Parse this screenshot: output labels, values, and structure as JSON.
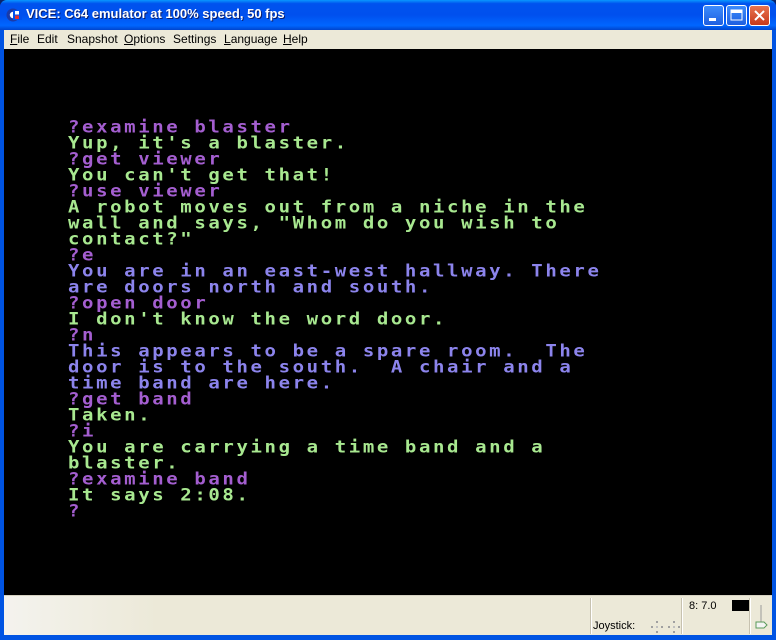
{
  "window": {
    "title": "VICE: C64 emulator at 100% speed, 50 fps",
    "icon": "c64-commodore-icon",
    "controls": [
      "minimize",
      "maximize",
      "close"
    ]
  },
  "menu": [
    {
      "label": "File",
      "mnemonic": "F",
      "rest": "ile"
    },
    {
      "label": "Edit",
      "mnemonic": "",
      "rest": "Edit"
    },
    {
      "label": "Snapshot",
      "mnemonic": "",
      "rest": "Snapshot"
    },
    {
      "label": "Options",
      "mnemonic": "O",
      "rest": "ptions"
    },
    {
      "label": "Settings",
      "mnemonic": "S",
      "rest": "ettings",
      "pre": "",
      "mid_under": "t"
    },
    {
      "label": "Language",
      "mnemonic": "L",
      "rest": "anguage"
    },
    {
      "label": "Help",
      "mnemonic": "H",
      "rest": "elp"
    }
  ],
  "screen": {
    "colors": {
      "command": "#a45ed0",
      "response": "#a8e890",
      "description": "#8c84ec",
      "background": "#000000"
    },
    "lines": [
      {
        "type": "cmd",
        "text": "?examine blaster"
      },
      {
        "type": "resp",
        "text": "Yup, it's a blaster."
      },
      {
        "type": "cmd",
        "text": "?get viewer"
      },
      {
        "type": "resp",
        "text": "You can't get that!"
      },
      {
        "type": "cmd",
        "text": "?use viewer"
      },
      {
        "type": "resp",
        "text": "A robot moves out from a niche in the"
      },
      {
        "type": "resp",
        "text": "wall and says, \"Whom do you wish to"
      },
      {
        "type": "resp",
        "text": "contact?\""
      },
      {
        "type": "cmd",
        "text": "?e"
      },
      {
        "type": "desc",
        "text": "You are in an east-west hallway. There"
      },
      {
        "type": "desc",
        "text": "are doors north and south."
      },
      {
        "type": "cmd",
        "text": "?open door"
      },
      {
        "type": "resp",
        "text": "I don't know the word door."
      },
      {
        "type": "cmd",
        "text": "?n"
      },
      {
        "type": "desc",
        "text": "This appears to be a spare room.  The"
      },
      {
        "type": "desc",
        "text": "door is to the south.  A chair and a"
      },
      {
        "type": "desc",
        "text": "time band are here."
      },
      {
        "type": "cmd",
        "text": "?get band"
      },
      {
        "type": "resp",
        "text": "Taken."
      },
      {
        "type": "cmd",
        "text": "?i"
      },
      {
        "type": "resp",
        "text": "You are carrying a time band and a"
      },
      {
        "type": "resp",
        "text": "blaster."
      },
      {
        "type": "cmd",
        "text": "?examine band"
      },
      {
        "type": "resp",
        "text": "It says 2:08."
      },
      {
        "type": "cmd",
        "text": "?"
      }
    ]
  },
  "statusbar": {
    "joystick_label": "Joystick:",
    "drive_status": "8: 7.0",
    "drive_led_color": "#000000"
  }
}
